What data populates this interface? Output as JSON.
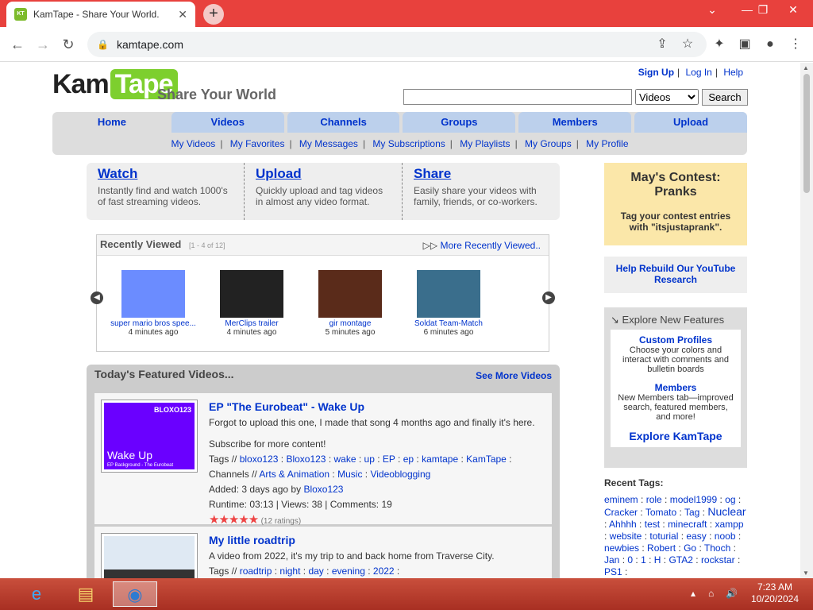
{
  "browser": {
    "tab_title": "KamTape - Share Your World.",
    "url": "kamtape.com",
    "win_min": "—",
    "win_restore": "❐",
    "win_close": "✕",
    "tab_close": "✕",
    "new_tab": "+"
  },
  "header": {
    "logo_left": "Kam",
    "logo_right": "Tape",
    "slogan": "Share Your World",
    "sign_up": "Sign Up",
    "log_in": "Log In",
    "help": "Help",
    "search_category": "Videos",
    "search_button": "Search"
  },
  "nav": {
    "tabs": [
      "Home",
      "Videos",
      "Channels",
      "Groups",
      "Members",
      "Upload"
    ],
    "sub": [
      "My Videos",
      "My Favorites",
      "My Messages",
      "My Subscriptions",
      "My Playlists",
      "My Groups",
      "My Profile"
    ]
  },
  "intro": [
    {
      "title": "Watch",
      "text": "Instantly find and watch 1000's of fast streaming videos."
    },
    {
      "title": "Upload",
      "text": "Quickly upload and tag videos in almost any video format."
    },
    {
      "title": "Share",
      "text": "Easily share your videos with family, friends, or co-workers."
    }
  ],
  "recent": {
    "title": "Recently Viewed",
    "count": "[1 - 4 of 12]",
    "more": "More Recently Viewed..",
    "items": [
      {
        "title": "super mario bros spee...",
        "ago": "4 minutes ago",
        "color": "#6b8cff"
      },
      {
        "title": "MerClips trailer",
        "ago": "4 minutes ago",
        "color": "#222222"
      },
      {
        "title": "gir montage",
        "ago": "5 minutes ago",
        "color": "#5a2b1a"
      },
      {
        "title": "Soldat Team-Match",
        "ago": "6 minutes ago",
        "color": "#3a6e8c"
      }
    ]
  },
  "featured": {
    "title": "Today's Featured Videos...",
    "more": "See More Videos",
    "videos": [
      {
        "title": "EP \"The Eurobeat\" - Wake Up",
        "desc": "Forgot to upload this one, I made that song 4 months ago and finally it's here.",
        "desc2": "Subscribe for more content!",
        "tags_label": "Tags //",
        "tags": [
          "bloxo123",
          "Bloxo123",
          "wake",
          "up",
          "EP",
          "ep",
          "kamtape",
          "KamTape"
        ],
        "channels_label": "Channels //",
        "channels": [
          "Arts & Animation",
          "Music",
          "Videoblogging"
        ],
        "added": "Added: 3 days ago by",
        "added_by": "Bloxo123",
        "stats": "Runtime: 03:13 | Views: 38 | Comments: 19",
        "ratings": "(12 ratings)",
        "thumb_brand": "BLOXO123",
        "thumb_text": "Wake Up",
        "thumb_sub": "EP Background - The Eurobeat"
      },
      {
        "title": "My little roadtrip",
        "desc": "A video from 2022, it's my trip to and back home from Traverse City.",
        "tags_label": "Tags //",
        "tags": [
          "roadtrip",
          "night",
          "day",
          "evening",
          "2022"
        ]
      }
    ]
  },
  "side": {
    "contest_title": "May's Contest: Pranks",
    "contest_text": "Tag your contest entries with \"itsjustaprank\".",
    "rebuild": "Help Rebuild Our YouTube Research",
    "explore_title": "Explore New Features",
    "custom_profiles": "Custom Profiles",
    "custom_profiles_text": "Choose your colors and interact with comments and bulletin boards",
    "members": "Members",
    "members_text": "New Members tab—improved search, featured members, and more!",
    "explore_link": "Explore KamTape",
    "recent_tags_title": "Recent Tags:",
    "tags": [
      "eminem",
      "role",
      "model1999",
      "og",
      "Cracker",
      "Tomato",
      "Tag",
      "Nuclear",
      "Ahhhh",
      "test",
      "minecraft",
      "xampp",
      "website",
      "toturial",
      "easy",
      "noob",
      "newbies",
      "Robert",
      "Go",
      "Thoch",
      "Jan",
      "0",
      "1",
      "H",
      "GTA2",
      "rockstar",
      "PS1"
    ]
  },
  "taskbar": {
    "time": "7:23 AM",
    "date": "10/20/2024"
  }
}
